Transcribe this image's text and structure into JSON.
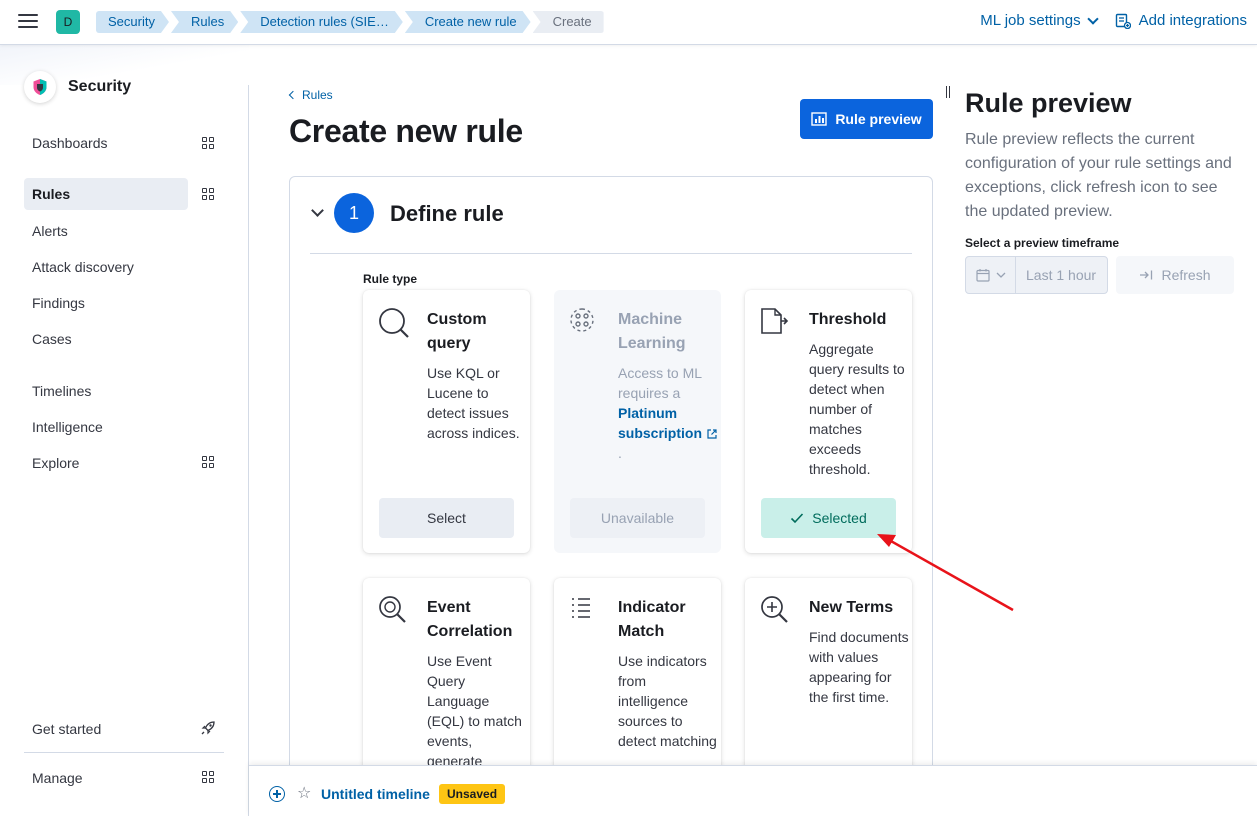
{
  "header": {
    "space_initial": "D",
    "breadcrumbs": [
      "Security",
      "Rules",
      "Detection rules (SIE…",
      "Create new rule",
      "Create"
    ],
    "ml_job_settings": "ML job settings",
    "add_integrations": "Add integrations"
  },
  "sidebar": {
    "app_title": "Security",
    "items": {
      "dashboards": "Dashboards",
      "rules": "Rules",
      "alerts": "Alerts",
      "attack_discovery": "Attack discovery",
      "findings": "Findings",
      "cases": "Cases",
      "timelines": "Timelines",
      "intelligence": "Intelligence",
      "explore": "Explore",
      "get_started": "Get started",
      "manage": "Manage"
    }
  },
  "main": {
    "back_link": "Rules",
    "page_title": "Create new rule",
    "rule_preview_button": "Rule preview",
    "step": {
      "number": "1",
      "title": "Define rule",
      "rule_type_label": "Rule type"
    },
    "cards": {
      "custom_query": {
        "title": "Custom query",
        "desc": "Use KQL or Lucene to detect issues across indices.",
        "button": "Select"
      },
      "machine_learning": {
        "title": "Machine Learning",
        "desc_prefix": "Access to ML requires a",
        "link": "Platinum subscription",
        "desc_suffix": ".",
        "button": "Unavailable"
      },
      "threshold": {
        "title": "Threshold",
        "desc": "Aggregate query results to detect when number of matches exceeds threshold.",
        "button": "Selected"
      },
      "event_correlation": {
        "title": "Event Correlation",
        "desc": "Use Event Query Language (EQL) to match events, generate"
      },
      "indicator_match": {
        "title": "Indicator Match",
        "desc": "Use indicators from intelligence sources to detect matching"
      },
      "new_terms": {
        "title": "New Terms",
        "desc": "Find documents with values appearing for the first time."
      }
    }
  },
  "preview": {
    "title": "Rule preview",
    "description": "Rule preview reflects the current configuration of your rule settings and exceptions, click refresh icon to see the updated preview.",
    "timeframe_label": "Select a preview timeframe",
    "timeframe_value": "Last 1 hour",
    "refresh": "Refresh"
  },
  "timeline": {
    "name": "Untitled timeline",
    "badge": "Unsaved"
  },
  "colors": {
    "primary": "#0b64dd",
    "link": "#0061a6",
    "selected_bg": "#c9efe9",
    "unsaved_badge": "#fec514",
    "annotation_arrow": "#e8131a"
  }
}
